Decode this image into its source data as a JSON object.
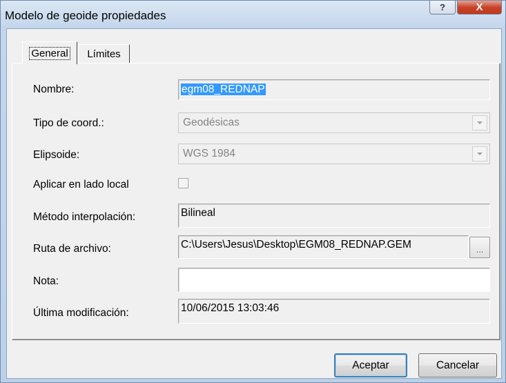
{
  "window": {
    "title": "Modelo de geoide propiedades",
    "help_glyph": "?",
    "close_glyph": "X"
  },
  "tabs": [
    {
      "label": "General",
      "selected": true
    },
    {
      "label": "Límites",
      "selected": false
    }
  ],
  "form": {
    "nombre": {
      "label": "Nombre:",
      "value": "egm08_REDNAP"
    },
    "tipo_coord": {
      "label": "Tipo de coord.:",
      "value": "Geodésicas"
    },
    "elipsoide": {
      "label": "Elipsoide:",
      "value": "WGS 1984"
    },
    "aplicar_local": {
      "label": "Aplicar en lado local",
      "checked": false
    },
    "metodo": {
      "label": "Método interpolación:",
      "value": "Bilineal"
    },
    "ruta": {
      "label": "Ruta de archivo:",
      "value": "C:\\Users\\Jesus\\Desktop\\EGM08_REDNAP.GEM",
      "browse_label": "..."
    },
    "nota": {
      "label": "Nota:",
      "value": ""
    },
    "ultima_mod": {
      "label": "Última modificación:",
      "value": "10/06/2015 13:03:46"
    }
  },
  "buttons": {
    "ok_label": "Aceptar",
    "cancel_label": "Cancelar"
  },
  "colors": {
    "selection": "#3399ff",
    "close_button": "#c7442a",
    "title_bar": "#c4d6ec"
  },
  "icons": {
    "help": "help-icon",
    "close": "close-icon",
    "dropdown": "chevron-down-icon"
  }
}
